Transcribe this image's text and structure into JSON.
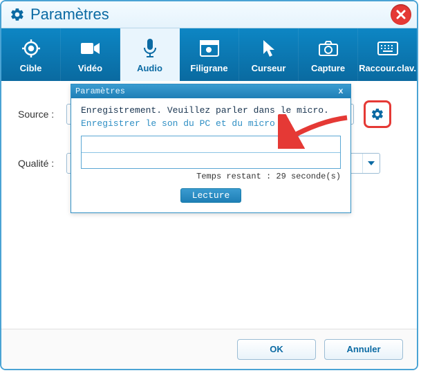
{
  "window": {
    "title": "Paramètres"
  },
  "tabs": {
    "items": [
      {
        "label": "Cible"
      },
      {
        "label": "Vidéo"
      },
      {
        "label": "Audio"
      },
      {
        "label": "Filigrane"
      },
      {
        "label": "Curseur"
      },
      {
        "label": "Capture"
      },
      {
        "label": "Raccour.clav."
      }
    ],
    "active_index": 2
  },
  "form": {
    "source_label": "Source :",
    "quality_label": "Qualité :"
  },
  "popup": {
    "title": "Paramètres",
    "line1": "Enregistrement. Veuillez parler dans le micro.",
    "line2": "Enregistrer le son du PC et du micro",
    "remaining": "Temps restant : 29 seconde(s)",
    "play_label": "Lecture"
  },
  "footer": {
    "ok": "OK",
    "cancel": "Annuler"
  },
  "colors": {
    "accent": "#0b6aa3",
    "danger": "#e53935"
  }
}
